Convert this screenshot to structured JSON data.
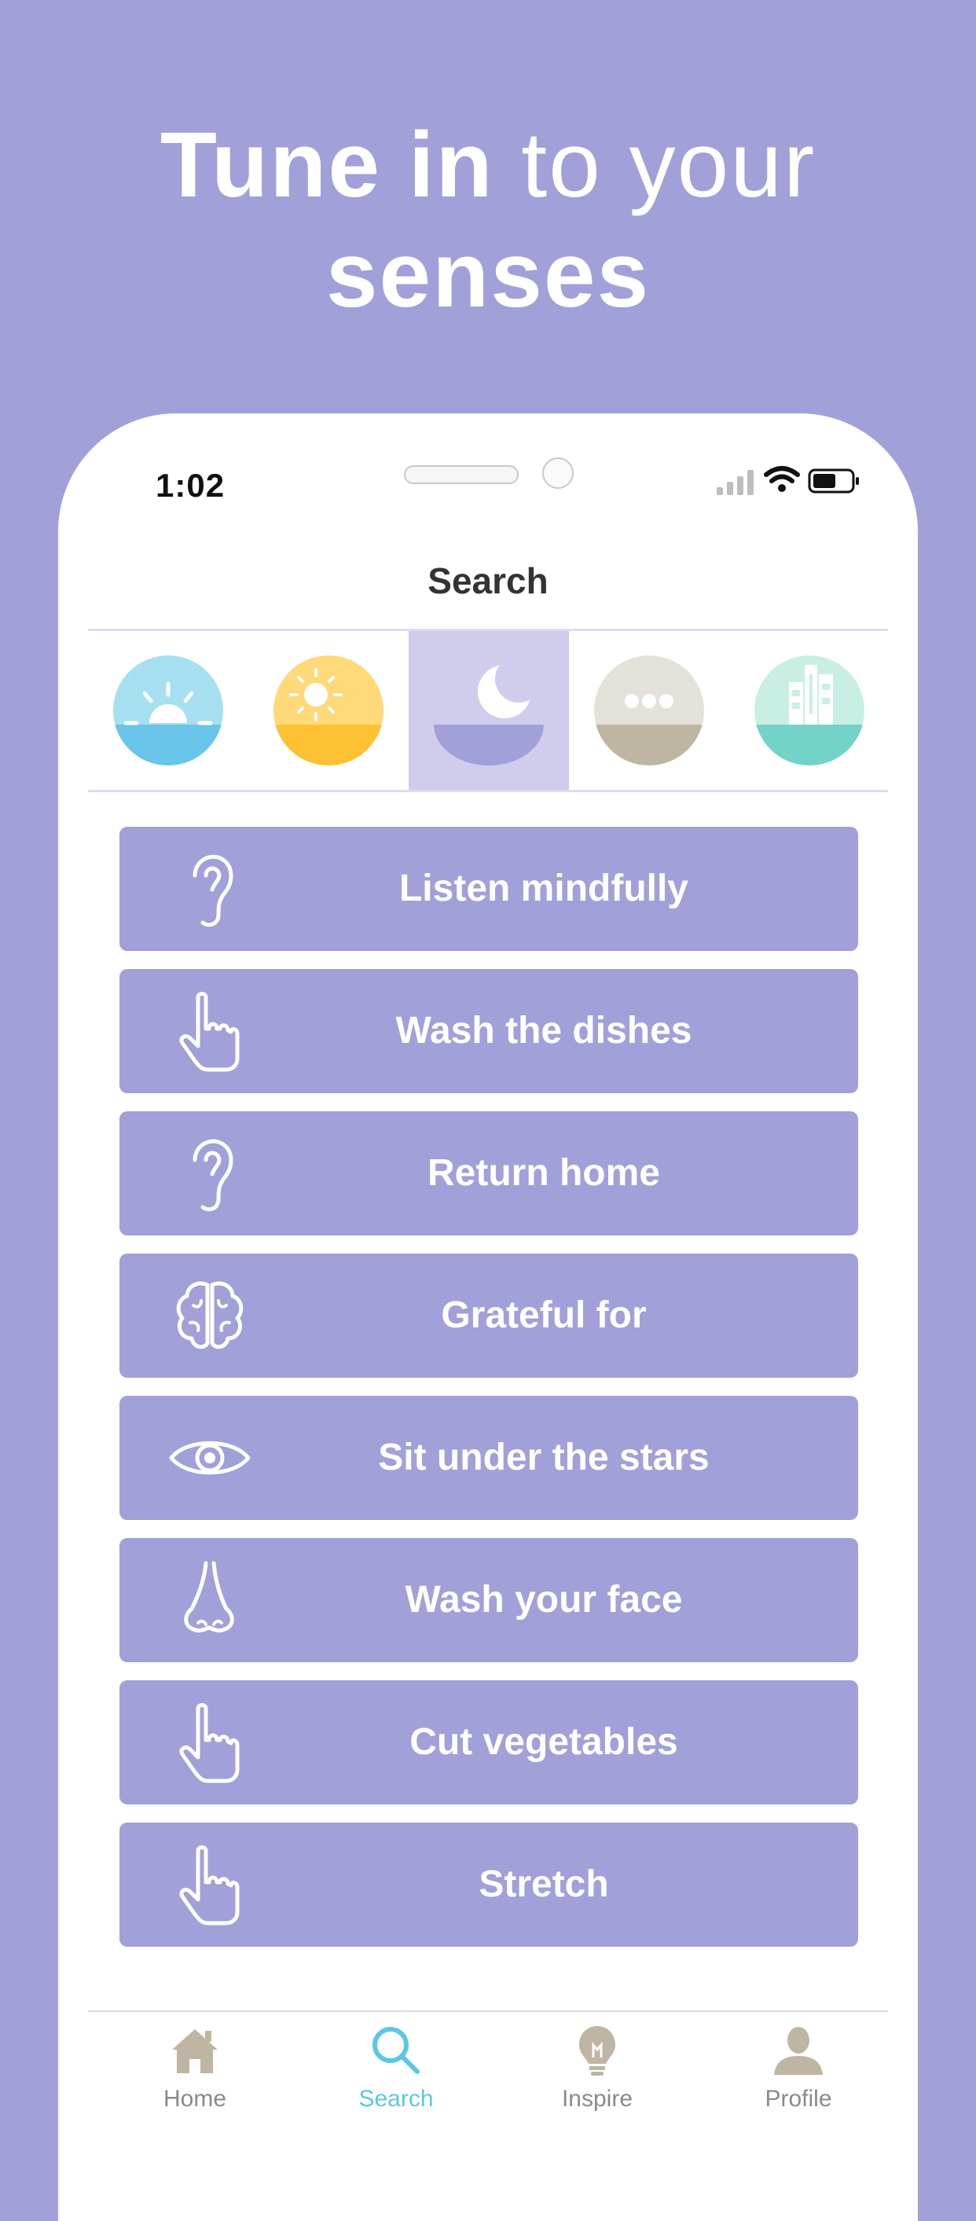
{
  "headline": {
    "bold_1": "Tune in",
    "light_1": "to your",
    "bold_2": "senses"
  },
  "status": {
    "time": "1:02"
  },
  "nav": {
    "title": "Search"
  },
  "categories": [
    {
      "icon": "sunrise-icon",
      "color_top": "#a6dff0",
      "color_bottom": "#69c5ea"
    },
    {
      "icon": "sun-icon",
      "color_top": "#ffd97a",
      "color_bottom": "#fdc133"
    },
    {
      "icon": "moon-icon",
      "color_top": "#ffffff",
      "color_bottom": "#a1a0d8",
      "selected": true
    },
    {
      "icon": "more-icon",
      "color_top": "#e4e1da",
      "color_bottom": "#bfb5a3"
    },
    {
      "icon": "city-icon",
      "color_top": "#c9efe4",
      "color_bottom": "#72d3c6"
    }
  ],
  "items": [
    {
      "label": "Listen mindfully",
      "icon": "ear-icon"
    },
    {
      "label": "Wash the dishes",
      "icon": "hand-pointer-icon"
    },
    {
      "label": "Return home",
      "icon": "ear-icon"
    },
    {
      "label": "Grateful for",
      "icon": "brain-icon"
    },
    {
      "label": "Sit under the stars",
      "icon": "eye-icon"
    },
    {
      "label": "Wash your face",
      "icon": "nose-icon"
    },
    {
      "label": "Cut vegetables",
      "icon": "hand-pointer-icon"
    },
    {
      "label": "Stretch",
      "icon": "hand-pointer-icon"
    }
  ],
  "tabs": [
    {
      "label": "Home",
      "icon": "home-icon"
    },
    {
      "label": "Search",
      "icon": "search-icon",
      "active": true
    },
    {
      "label": "Inspire",
      "icon": "lightbulb-icon"
    },
    {
      "label": "Profile",
      "icon": "profile-icon"
    }
  ],
  "colors": {
    "background": "#a1a0d8",
    "accent": "#5bc7e4",
    "item_bg": "#a1a0d8"
  }
}
